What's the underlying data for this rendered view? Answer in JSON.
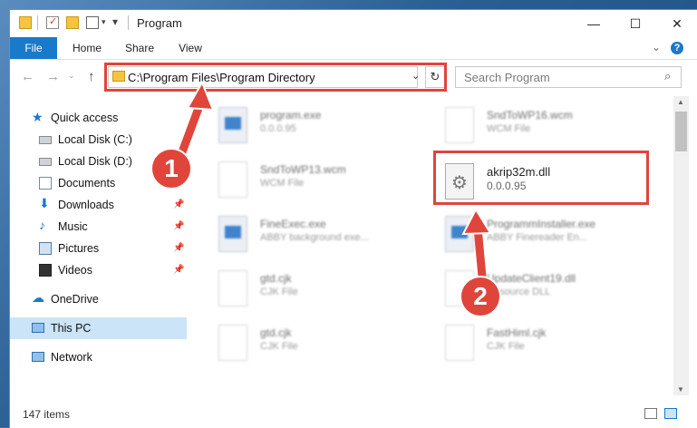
{
  "window": {
    "title": "Program",
    "controls": {
      "minimize": "—",
      "maximize": "☐",
      "close": "✕"
    }
  },
  "ribbon": {
    "tabs": [
      "File",
      "Home",
      "Share",
      "View"
    ]
  },
  "address": {
    "path": "C:\\Program Files\\Program Directory",
    "search_placeholder": "Search Program"
  },
  "nav": {
    "items": [
      {
        "label": "Quick access",
        "icon": "star-icon"
      },
      {
        "label": "Local Disk (C:)",
        "icon": "drive-icon"
      },
      {
        "label": "Local Disk (D:)",
        "icon": "drive-icon"
      },
      {
        "label": "Documents",
        "icon": "documents-icon"
      },
      {
        "label": "Downloads",
        "icon": "download-icon"
      },
      {
        "label": "Music",
        "icon": "music-icon"
      },
      {
        "label": "Pictures",
        "icon": "pictures-icon"
      },
      {
        "label": "Videos",
        "icon": "videos-icon"
      },
      {
        "label": "OneDrive",
        "icon": "cloud-icon"
      },
      {
        "label": "This PC",
        "icon": "computer-icon"
      },
      {
        "label": "Network",
        "icon": "network-icon"
      }
    ]
  },
  "files": [
    {
      "name": "program.exe",
      "sub": "0.0.0.95"
    },
    {
      "name": "SndToWP16.wcm",
      "sub": "WCM File"
    },
    {
      "name": "SndToWP13.wcm",
      "sub": "WCM File"
    },
    {
      "name": "akrip32m.dll",
      "sub": "0.0.0.95"
    },
    {
      "name": "FineExec.exe",
      "sub": "ABBY background exe..."
    },
    {
      "name": "ProgrammInstaller.exe",
      "sub": "ABBY Finereader En..."
    },
    {
      "name": "gtd.cjk",
      "sub": "CJK File"
    },
    {
      "name": "UpdateClient19.dll",
      "sub": "Resource DLL"
    },
    {
      "name": "gtd.cjk",
      "sub": "CJK File"
    },
    {
      "name": "FastHiml.cjk",
      "sub": "CJK File"
    }
  ],
  "status": {
    "item_count": "147 items"
  },
  "annotations": {
    "step1": "1",
    "step2": "2"
  },
  "colors": {
    "accent": "#1979ca",
    "annotation_red": "#e0453c",
    "selection": "#cce4f7"
  }
}
